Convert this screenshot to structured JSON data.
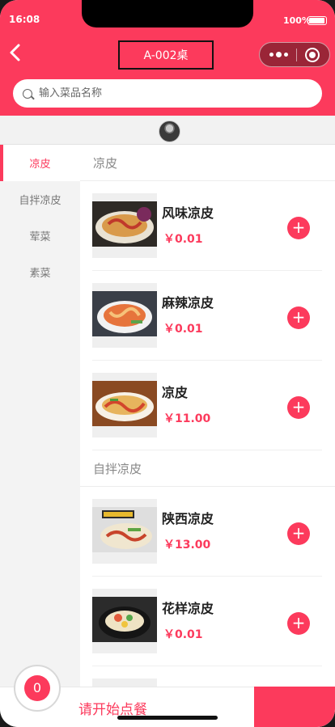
{
  "status": {
    "time": "16:08",
    "battery": "100%"
  },
  "header": {
    "title": "A-002桌",
    "background": "#fc3a5c"
  },
  "search": {
    "placeholder": "输入菜品名称",
    "value": ""
  },
  "sidebar": {
    "items": [
      {
        "label": "凉皮",
        "active": true
      },
      {
        "label": "自拌凉皮",
        "active": false
      },
      {
        "label": "荤菜",
        "active": false
      },
      {
        "label": "素菜",
        "active": false
      }
    ]
  },
  "sections": [
    {
      "title": "凉皮",
      "dishes": [
        {
          "name": "风味凉皮",
          "price": "￥0.01"
        },
        {
          "name": "麻辣凉皮",
          "price": "￥0.01"
        },
        {
          "name": "凉皮",
          "price": "￥11.00"
        }
      ]
    },
    {
      "title": "自拌凉皮",
      "dishes": [
        {
          "name": "陕西凉皮",
          "price": "￥13.00"
        },
        {
          "name": "花样凉皮",
          "price": "￥0.01"
        }
      ]
    }
  ],
  "add_label": "+",
  "cart": {
    "count": "0"
  },
  "bottom": {
    "prompt": "请开始点餐"
  },
  "colors": {
    "accent": "#fc3a5c",
    "sidebar_bg": "#f3f3f3"
  }
}
